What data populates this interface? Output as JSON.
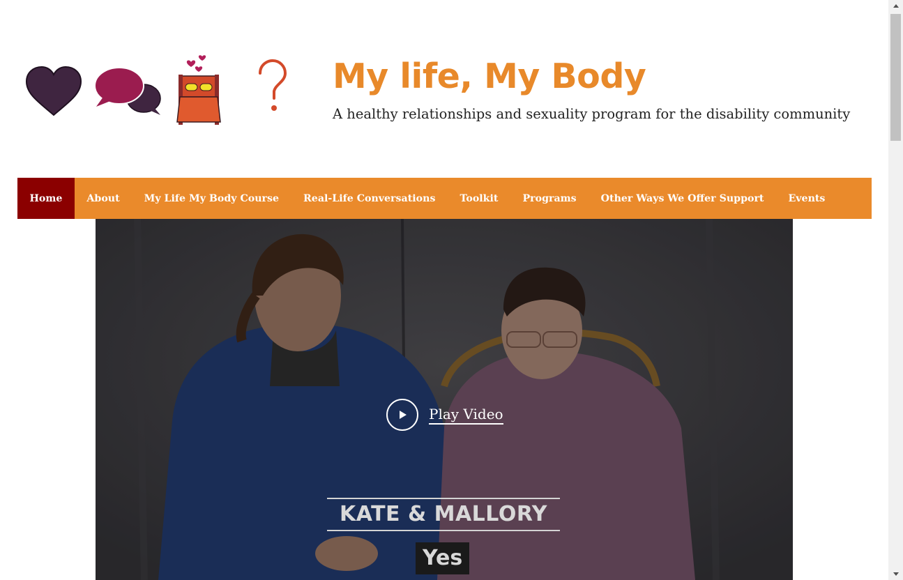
{
  "header": {
    "title": "My life, My Body",
    "tagline": "A healthy relationships and sexuality program for the disability community",
    "logo_icons": [
      "heart-icon",
      "speech-bubbles-icon",
      "bed-icon",
      "question-mark-icon"
    ]
  },
  "nav": {
    "items": [
      {
        "label": "Home",
        "active": true
      },
      {
        "label": "About",
        "active": false
      },
      {
        "label": "My Life My Body Course",
        "active": false
      },
      {
        "label": "Real-Life Conversations",
        "active": false
      },
      {
        "label": "Toolkit",
        "active": false
      },
      {
        "label": "Programs",
        "active": false
      },
      {
        "label": "Other Ways We Offer Support",
        "active": false
      },
      {
        "label": "Events",
        "active": false
      }
    ]
  },
  "video": {
    "play_label": "Play Video",
    "name_card": "KATE & MALLORY",
    "caption": "Yes"
  },
  "colors": {
    "accent_orange": "#ea8a2b",
    "nav_active": "#8b0000",
    "title_orange": "#e8892a",
    "heart_purple": "#3f2540",
    "bubble_magenta": "#9b1c4f"
  }
}
